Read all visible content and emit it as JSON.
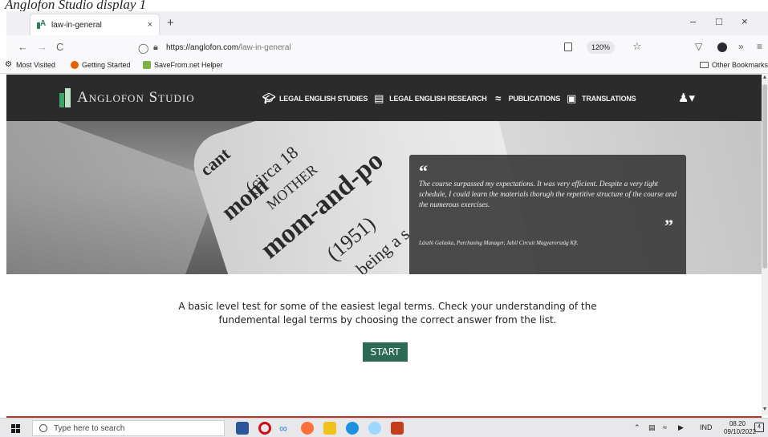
{
  "caption": "Anglofon Studio display 1",
  "browser": {
    "tab_title": "law-in-general",
    "tab_close": "×",
    "new_tab": "+",
    "url_host": "https://anglofon.com",
    "url_path": "/law-in-general",
    "zoom": "120%",
    "window_controls": [
      "–",
      "□",
      "×"
    ],
    "back": "←",
    "forward": "→",
    "reload": "C",
    "overflow": "»",
    "menu": "≡"
  },
  "bookmarks": {
    "items": [
      "Most Visited",
      "Getting Started",
      "SaveFrom.net Helper"
    ],
    "other": "Other Bookmarks"
  },
  "site": {
    "logo": "Anglofon Studio",
    "menu": [
      "LEGAL ENGLISH STUDIES",
      "LEGAL ENGLISH RESEARCH",
      "PUBLICATIONS",
      "TRANSLATIONS"
    ]
  },
  "hero": {
    "quote_open": "“",
    "quote_text": "The course surpassed my expectations. It was very efficient. Despite a very tight schedule, I could learn the materials thorugh the repetitive structure of the course and the numerous exercises.",
    "quote_close": "”",
    "quote_author": "László Galuska, Purchasing Manager, Jabil Circuit Magyarország Kft.",
    "book_words": [
      "mom",
      "(circa 18",
      "MOTHER",
      "mom-and-po",
      "(1951)",
      "cant",
      "being a s"
    ]
  },
  "content": {
    "intro": "A basic level test for some of the easiest legal terms. Check your understanding of the fundemental legal terms by choosing the correct answer from the list.",
    "start_label": "START"
  },
  "taskbar": {
    "search_placeholder": "Type here to search",
    "tray_lang": "IND",
    "time": "08.20",
    "date": "09/10/2022",
    "notifications": "4"
  },
  "colors": {
    "header_bg": "#2b2b2b",
    "start_button": "#2d6a55",
    "logo_green": "#3da36a"
  }
}
